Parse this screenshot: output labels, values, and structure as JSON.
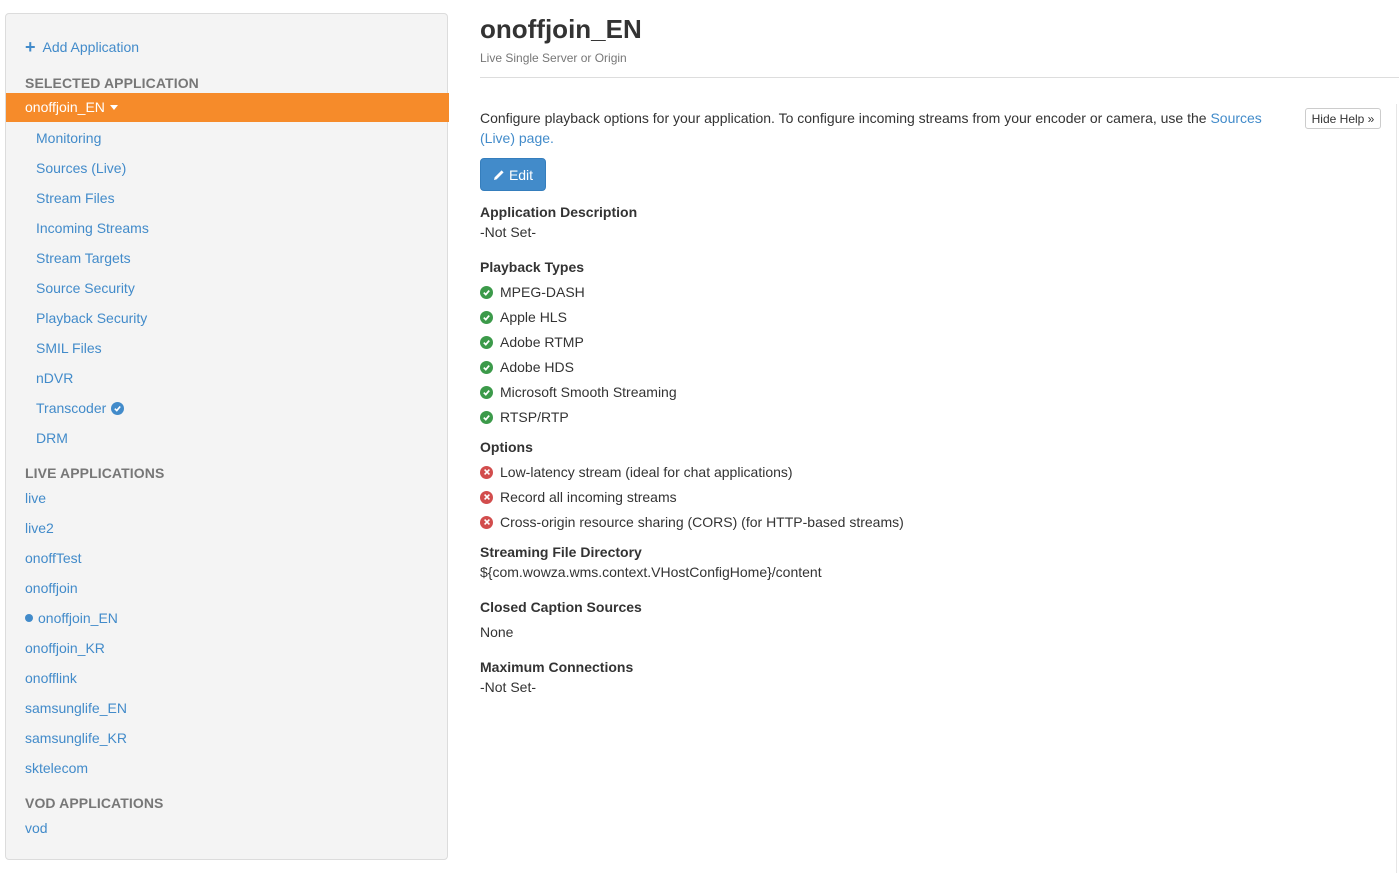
{
  "sidebar": {
    "add_application": "Add Application",
    "selected_header": "SELECTED APPLICATION",
    "selected_app": "onoffjoin_EN",
    "selected_menu": [
      {
        "label": "Monitoring"
      },
      {
        "label": "Sources (Live)"
      },
      {
        "label": "Stream Files"
      },
      {
        "label": "Incoming Streams"
      },
      {
        "label": "Stream Targets"
      },
      {
        "label": "Source Security"
      },
      {
        "label": "Playback Security"
      },
      {
        "label": "SMIL Files"
      },
      {
        "label": "nDVR"
      },
      {
        "label": "Transcoder"
      },
      {
        "label": "DRM"
      }
    ],
    "live_header": "LIVE APPLICATIONS",
    "live_apps": [
      {
        "label": "live"
      },
      {
        "label": "live2"
      },
      {
        "label": "onoffTest"
      },
      {
        "label": "onoffjoin"
      },
      {
        "label": "onoffjoin_EN"
      },
      {
        "label": "onoffjoin_KR"
      },
      {
        "label": "onofflink"
      },
      {
        "label": "samsunglife_EN"
      },
      {
        "label": "samsunglife_KR"
      },
      {
        "label": "sktelecom"
      }
    ],
    "vod_header": "VOD APPLICATIONS",
    "vod_apps": [
      {
        "label": "vod"
      }
    ]
  },
  "main": {
    "title": "onoffjoin_EN",
    "subtitle": "Live Single Server or Origin",
    "help_text": "Configure playback options for your application. To configure incoming streams from your encoder or camera, use the ",
    "help_link": "Sources (Live) page.",
    "hide_help": "Hide Help »",
    "edit": "Edit",
    "app_desc_label": "Application Description",
    "app_desc_value": "-Not Set-",
    "playback_label": "Playback Types",
    "playback_types": [
      {
        "label": "MPEG-DASH",
        "enabled": true
      },
      {
        "label": "Apple HLS",
        "enabled": true
      },
      {
        "label": "Adobe RTMP",
        "enabled": true
      },
      {
        "label": "Adobe HDS",
        "enabled": true
      },
      {
        "label": "Microsoft Smooth Streaming",
        "enabled": true
      },
      {
        "label": "RTSP/RTP",
        "enabled": true
      }
    ],
    "options_label": "Options",
    "options": [
      {
        "label": "Low-latency stream (ideal for chat applications)",
        "enabled": false
      },
      {
        "label": "Record all incoming streams",
        "enabled": false
      },
      {
        "label": "Cross-origin resource sharing (CORS) (for HTTP-based streams)",
        "enabled": false
      }
    ],
    "file_dir_label": "Streaming File Directory",
    "file_dir_value": "${com.wowza.wms.context.VHostConfigHome}/content",
    "cc_label": "Closed Caption Sources",
    "cc_value": "None",
    "max_conn_label": "Maximum Connections",
    "max_conn_value": "-Not Set-"
  },
  "colors": {
    "accent": "#f68b2a",
    "link": "#428bca",
    "enabled": "#3c9a4a",
    "disabled": "#d24d4d"
  }
}
